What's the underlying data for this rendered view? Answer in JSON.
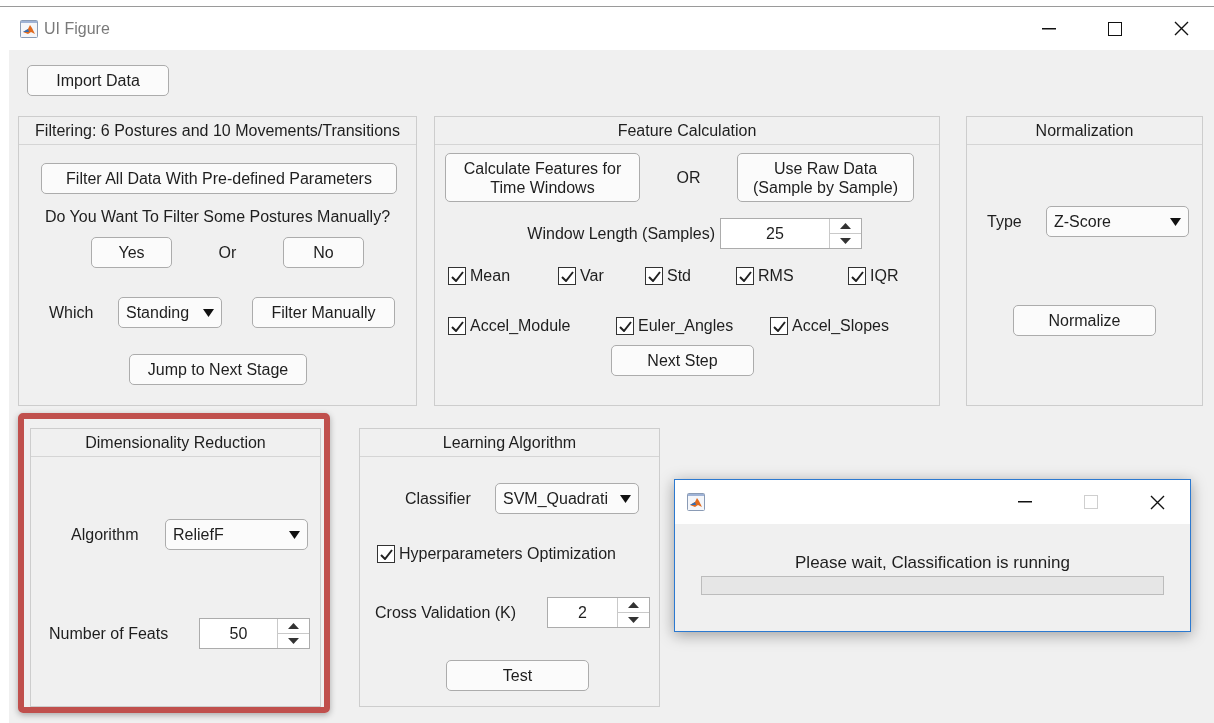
{
  "window": {
    "title": "UI Figure",
    "maximize_disabled": false
  },
  "import_button": "Import Data",
  "filtering": {
    "title": "Filtering: 6 Postures and 10 Movements/Transitions",
    "filter_all_button": "Filter All Data With Pre-defined Parameters",
    "question": "Do You Want To Filter Some Postures Manually?",
    "yes_button": "Yes",
    "or_label": "Or",
    "no_button": "No",
    "which_label": "Which",
    "which_dropdown": "Standing",
    "filter_manually_button": "Filter Manually",
    "next_stage_button": "Jump to Next Stage"
  },
  "feature_calculation": {
    "title": "Feature Calculation",
    "calculate_button": "Calculate Features for\nTime Windows",
    "or_label": "OR",
    "raw_data_button": "Use Raw Data\n(Sample by Sample)",
    "window_length_label": "Window Length (Samples)",
    "window_length_value": "25",
    "feature_rows": [
      {
        "features": [
          {
            "label": "Mean",
            "checked": true
          },
          {
            "label": "Var",
            "checked": true
          },
          {
            "label": "Std",
            "checked": true
          },
          {
            "label": "RMS",
            "checked": true
          },
          {
            "label": "IQR",
            "checked": true
          }
        ]
      },
      {
        "features": [
          {
            "label": "Accel_Module",
            "checked": true
          },
          {
            "label": "Euler_Angles",
            "checked": true
          },
          {
            "label": "Accel_Slopes",
            "checked": true
          }
        ]
      }
    ],
    "next_step_button": "Next Step"
  },
  "normalization": {
    "title": "Normalization",
    "type_label": "Type",
    "type_dropdown": "Z-Score",
    "normalize_button": "Normalize"
  },
  "dimensionality_reduction": {
    "title": "Dimensionality Reduction",
    "highlighted": true,
    "algorithm_label": "Algorithm",
    "algorithm_dropdown": "ReliefF",
    "feats_label": "Number of Feats",
    "feats_value": "50"
  },
  "learning_algorithm": {
    "title": "Learning Algorithm",
    "classifier_label": "Classifier",
    "classifier_dropdown": "SVM_Quadrati",
    "hyperparameter_optimization": {
      "label": "Hyperparameters Optimization",
      "checked": true
    },
    "cross_validation_label": "Cross Validation (K)",
    "cross_validation_value": "2",
    "test_button": "Test"
  },
  "dialog": {
    "maximize_disabled": true,
    "message": "Please wait, Classification is running",
    "progress": {
      "level": 0
    }
  }
}
